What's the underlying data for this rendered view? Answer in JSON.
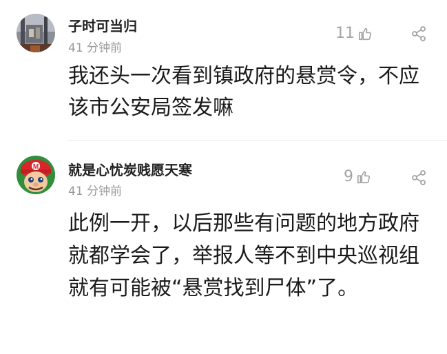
{
  "comments": [
    {
      "username": "子时可当归",
      "time": "41 分钟前",
      "likes": "11",
      "text": "我还头一次看到镇政府的悬赏令，不应该市公安局签发嘛",
      "avatar": "photo-avatar-street-scene"
    },
    {
      "username": "就是心忧炭贱愿天寒",
      "time": "41 分钟前",
      "likes": "9",
      "text": "此例一开，以后那些有问题的地方政府就都学会了，举报人等不到中央巡视组就有可能被“悬赏找到尸体”了。",
      "avatar": "cartoon-plumber-avatar"
    }
  ],
  "icons": {
    "like": "thumbs-up-icon",
    "share": "share-icon"
  },
  "colors": {
    "text": "#1a1a1a",
    "meta": "#9a9a9a",
    "icon": "#a3a3a3",
    "divider": "#e6e6e6"
  }
}
